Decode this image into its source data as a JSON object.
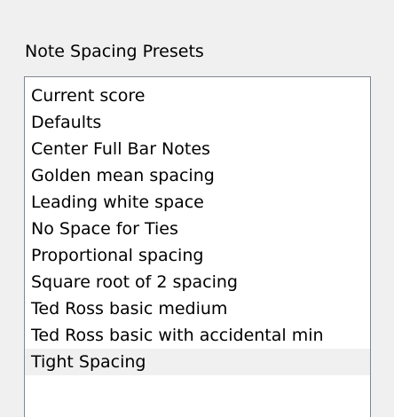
{
  "presets": {
    "label": "Note Spacing Presets",
    "selected_index": 10,
    "items": [
      "Current score",
      "Defaults",
      "Center Full Bar Notes",
      "Golden mean spacing",
      "Leading white space",
      "No Space for Ties",
      "Proportional spacing",
      "Square root of 2 spacing",
      "Ted Ross basic medium",
      "Ted Ross basic with accidental min",
      "Tight Spacing"
    ]
  }
}
